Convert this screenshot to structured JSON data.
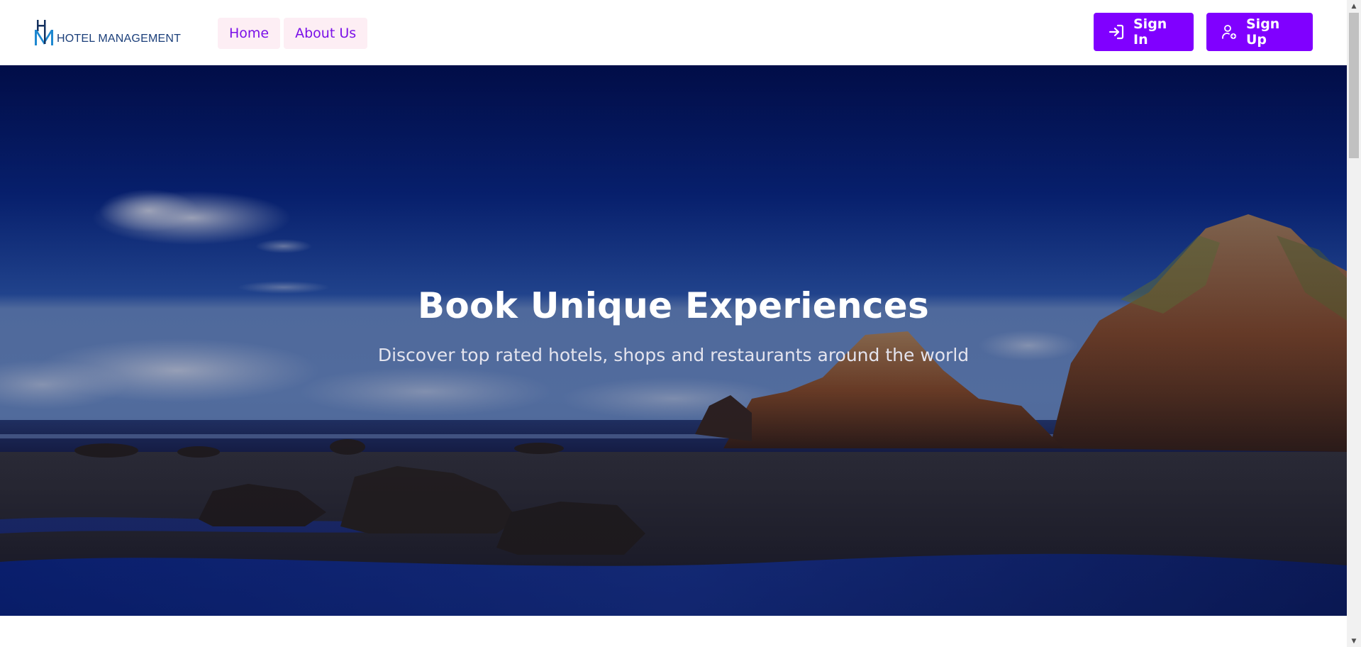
{
  "header": {
    "logo_text": "HOTEL MANAGEMENT",
    "nav": [
      {
        "label": "Home"
      },
      {
        "label": "About Us"
      }
    ],
    "sign_in_label": "Sign In",
    "sign_up_label": "Sign Up"
  },
  "hero": {
    "title": "Book Unique Experiences",
    "subtitle": "Discover top rated hotels, shops and restaurants around the world"
  },
  "icons": {
    "sign_in": "login-arrow-icon",
    "sign_up": "user-plus-icon",
    "logo": "hm-logo-icon"
  },
  "colors": {
    "brand_purple": "#8000ff",
    "nav_link_text": "#7a10e8",
    "nav_link_bg": "#fdeef4",
    "logo_blue": "#1b3f7a"
  }
}
